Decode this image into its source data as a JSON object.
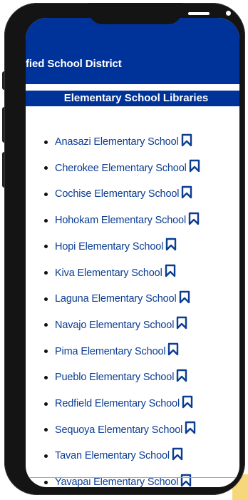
{
  "header": {
    "title": "fied School District"
  },
  "section": {
    "title": "Elementary School Libraries"
  },
  "schools": [
    "Anasazi Elementary School",
    "Cherokee Elementary School",
    "Cochise Elementary School",
    "Hohokam Elementary School",
    "Hopi Elementary School",
    "Kiva Elementary School",
    "Laguna Elementary School",
    "Navajo Elementary School",
    "Pima Elementary School",
    "Pueblo Elementary School",
    "Redfield Elementary School",
    "Sequoya Elementary School",
    "Tavan Elementary School",
    "Yavapai Elementary School"
  ],
  "icons": {
    "bookmark": "bookmark-icon"
  },
  "colors": {
    "header_bg": "#003399",
    "link": "#0b3d91",
    "accent": "#f6d77a"
  }
}
